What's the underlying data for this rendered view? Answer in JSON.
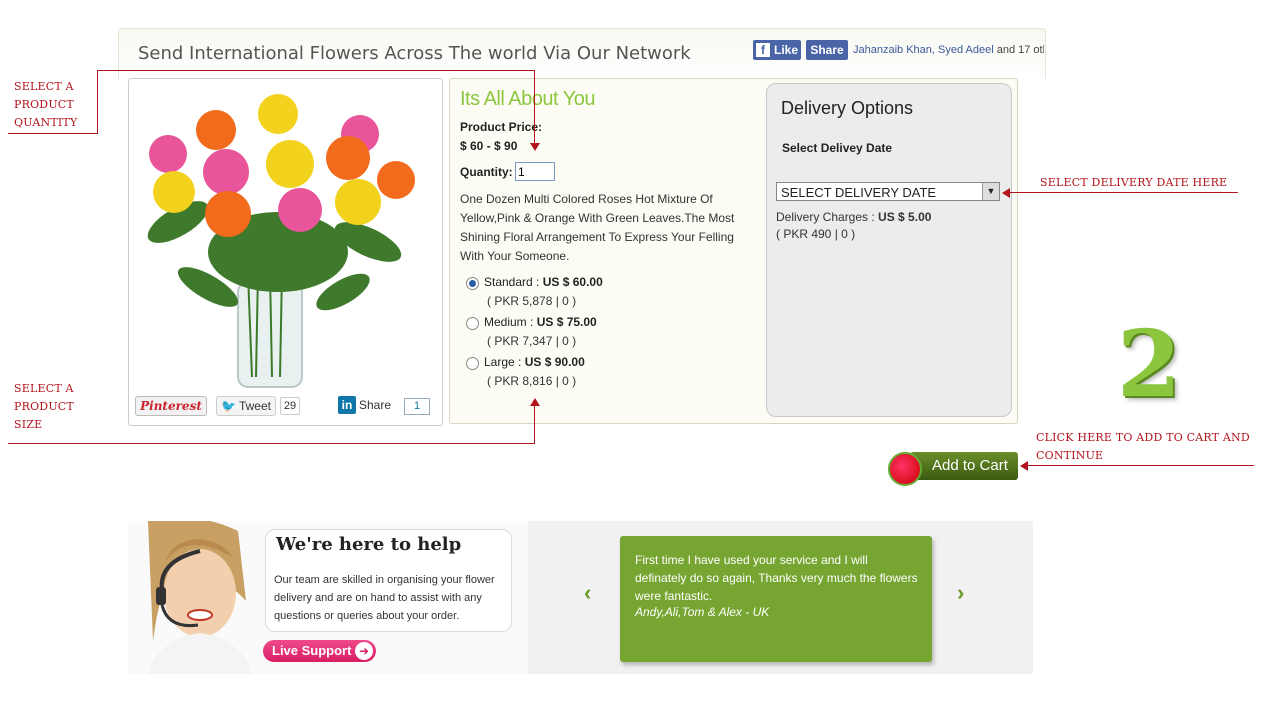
{
  "header": {
    "title": "Send International Flowers Across The world Via Our Network",
    "fb_like": "Like",
    "fb_share": "Share",
    "fb_social_names": "Jahanzaib Khan, Syed Adeel",
    "fb_social_suffix": " and 17 oth"
  },
  "social": {
    "pinterest": "Pinterest",
    "tweet": "Tweet",
    "tweet_count": "29",
    "linkedin_share": "Share",
    "linkedin_count": "1"
  },
  "product": {
    "heading": "Its All About You",
    "price_label": "Product Price:",
    "price_range": "$ 60 - $ 90",
    "quantity_label": "Quantity:",
    "quantity_value": "1",
    "description": "One Dozen Multi Colored Roses Hot Mixture Of Yellow,Pink & Orange With Green Leaves.The Most Shining Floral Arrangement To Express Your Felling With Your Someone.",
    "options": [
      {
        "name": "Standard : ",
        "price": "US $ 60.00",
        "pkr": "( PKR 5,878 |  0 )",
        "selected": true
      },
      {
        "name": "Medium : ",
        "price": "US $ 75.00",
        "pkr": "( PKR 7,347 |  0 )",
        "selected": false
      },
      {
        "name": "Large : ",
        "price": "US $ 90.00",
        "pkr": "( PKR 8,816 |  0 )",
        "selected": false
      }
    ]
  },
  "delivery": {
    "title": "Delivery Options",
    "subtitle": "Select Delivey Date",
    "select_value": "SELECT DELIVERY DATE",
    "charges_label": "Delivery Charges : ",
    "charges_value": "US $ 5.00",
    "charges_pkr": "( PKR 490 |  0 )"
  },
  "annotations": {
    "quantity": [
      "Select a",
      "product",
      "quantity"
    ],
    "size": [
      "Select a",
      "product",
      "size"
    ],
    "delivery_date": "Select delivery date here",
    "add_to_cart": [
      "Click here to add to cart and",
      "continue"
    ]
  },
  "step": "2",
  "cart": {
    "label": "Add to Cart"
  },
  "help": {
    "title": "We're here to help",
    "text": "Our team are skilled in organising your flower delivery and are on hand to assist with any questions or queries about your order.",
    "live_support": "Live Support"
  },
  "testimonial": {
    "text": "First time I have used your service and I will definately do so again, Thanks very much the flowers were fantastic.",
    "author": "Andy,Ali,Tom & Alex - UK",
    "prev": "‹",
    "next": "›"
  },
  "colors": {
    "accent_green": "#8cc63f",
    "annotation_red": "#b3141c",
    "facebook_blue": "#4a64a8",
    "testimonial_green": "#76a532",
    "live_support_pink": "#d81e65"
  }
}
